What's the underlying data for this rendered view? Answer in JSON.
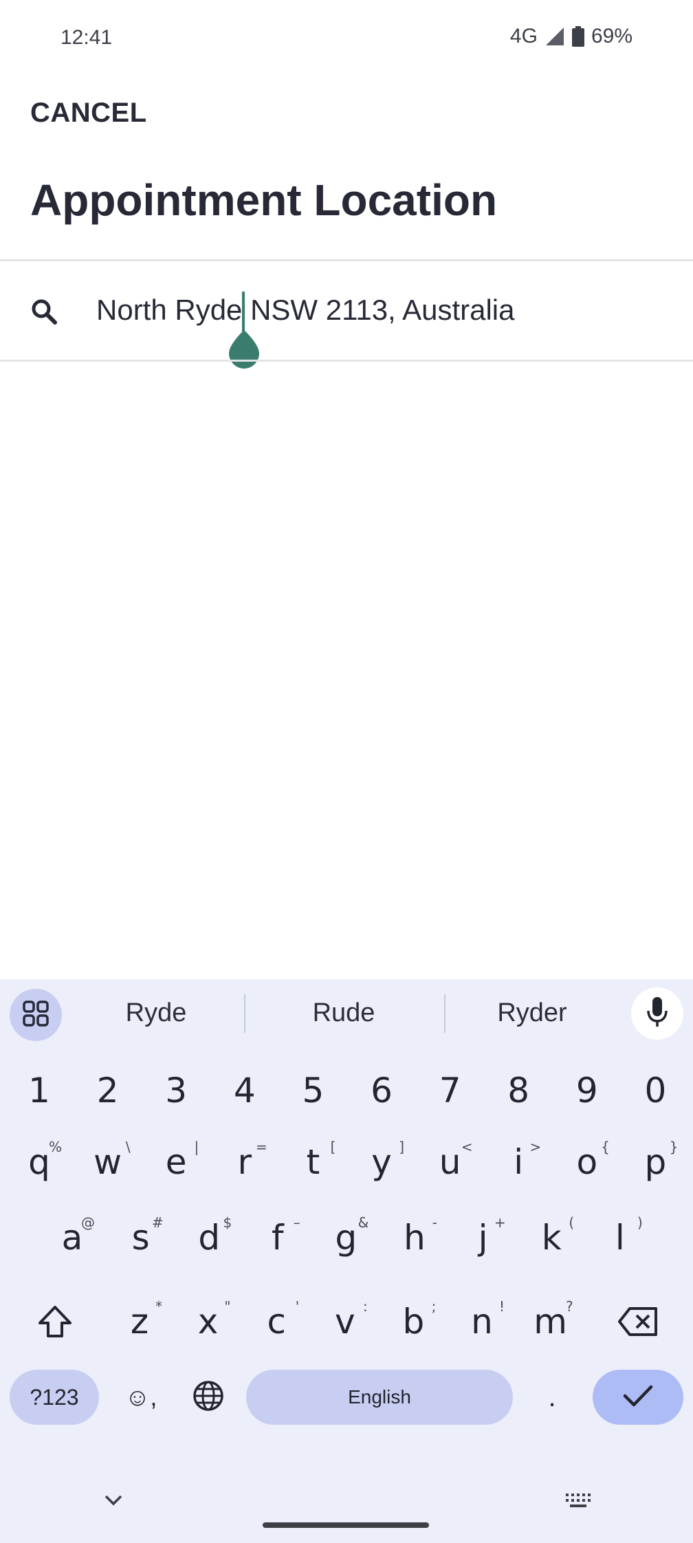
{
  "status_bar": {
    "time": "12:41",
    "network": "4G",
    "battery": "69%"
  },
  "header": {
    "cancel_label": "CANCEL",
    "title": "Appointment Location"
  },
  "search": {
    "value": "North Ryde NSW 2113, Australia",
    "icon": "search-icon"
  },
  "keyboard": {
    "suggestions": [
      "Ryde",
      "Rude",
      "Ryder"
    ],
    "number_row": [
      "1",
      "2",
      "3",
      "4",
      "5",
      "6",
      "7",
      "8",
      "9",
      "0"
    ],
    "row1": [
      {
        "key": "q",
        "hint": "%"
      },
      {
        "key": "w",
        "hint": "\\"
      },
      {
        "key": "e",
        "hint": "|"
      },
      {
        "key": "r",
        "hint": "="
      },
      {
        "key": "t",
        "hint": "["
      },
      {
        "key": "y",
        "hint": "]"
      },
      {
        "key": "u",
        "hint": "<"
      },
      {
        "key": "i",
        "hint": ">"
      },
      {
        "key": "o",
        "hint": "{"
      },
      {
        "key": "p",
        "hint": "}"
      }
    ],
    "row2": [
      {
        "key": "a",
        "hint": "@"
      },
      {
        "key": "s",
        "hint": "#"
      },
      {
        "key": "d",
        "hint": "$"
      },
      {
        "key": "f",
        "hint": "–"
      },
      {
        "key": "g",
        "hint": "&"
      },
      {
        "key": "h",
        "hint": "-"
      },
      {
        "key": "j",
        "hint": "+"
      },
      {
        "key": "k",
        "hint": "("
      },
      {
        "key": "l",
        "hint": ")"
      }
    ],
    "row3": [
      {
        "key": "z",
        "hint": "*"
      },
      {
        "key": "x",
        "hint": "\""
      },
      {
        "key": "c",
        "hint": "'"
      },
      {
        "key": "v",
        "hint": ":"
      },
      {
        "key": "b",
        "hint": ";"
      },
      {
        "key": "n",
        "hint": "!"
      },
      {
        "key": "m",
        "hint": "?"
      }
    ],
    "symbols_label": "?123",
    "emoji_label": "☺,",
    "space_label": "English",
    "period_label": ".",
    "accent_color": "#c8cdf2",
    "enter_color": "#aebcf5"
  }
}
